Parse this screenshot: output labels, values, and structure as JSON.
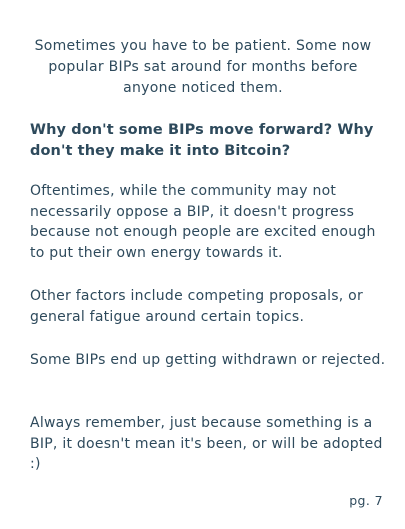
{
  "intro": "Sometimes you have to be patient. Some now popular BIPs sat around for months before anyone noticed them.",
  "heading": "Why don't some BIPs move forward? Why don't they make it into Bitcoin?",
  "paragraphs": [
    "Oftentimes, while the community may not necessarily oppose a BIP, it doesn't progress because not enough people are excited enough to put their own energy towards it.",
    "Other factors include competing proposals, or general fatigue around certain topics.",
    "Some BIPs end up getting withdrawn or rejected.",
    "Always remember, just because something is a BIP, it doesn't mean it's been, or will be adopted :)"
  ],
  "page_number": "pg. 7"
}
